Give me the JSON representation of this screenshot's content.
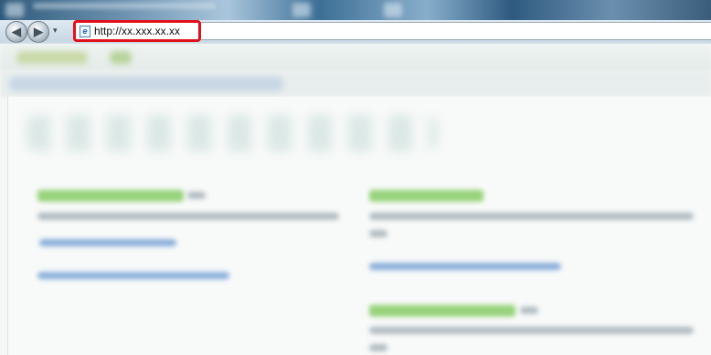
{
  "window": {
    "title_bar": {
      "icons": [
        "browser-icon",
        "page-icon",
        "page-icon"
      ]
    }
  },
  "navigation": {
    "back_glyph": "◀",
    "forward_glyph": "▶",
    "dropdown_glyph": "▾",
    "address_url": "http://xx.xxx.xx.xx",
    "address_icon_glyph": "e"
  },
  "colors": {
    "highlight_border": "#e0101c",
    "heading_green": "#7fc95b",
    "link_blue": "#7ea6d6",
    "body_text_gray": "#9aa6ae"
  }
}
